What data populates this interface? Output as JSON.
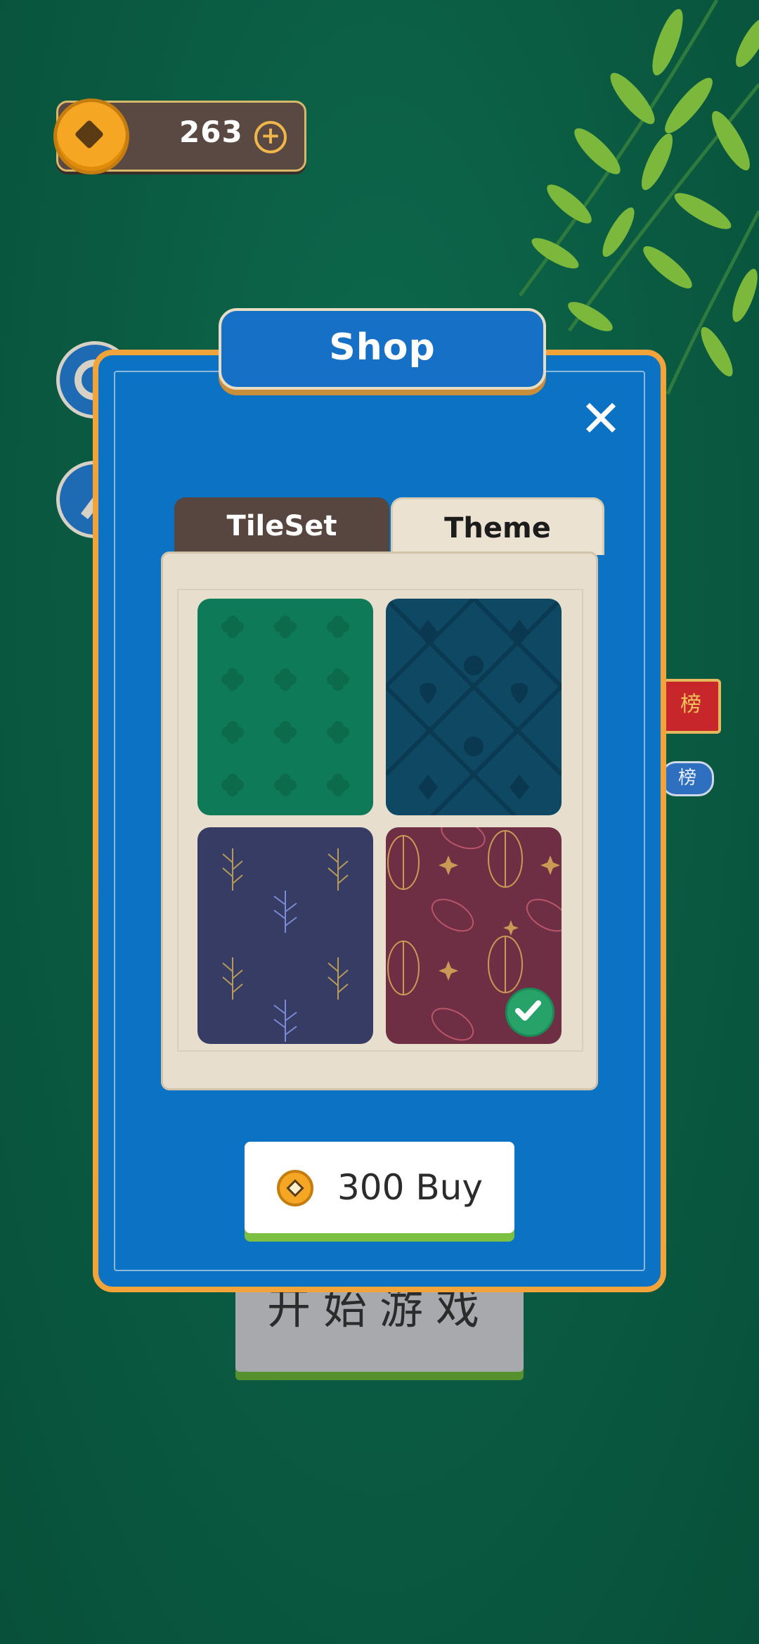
{
  "header": {
    "coins": "263",
    "add_coins_symbol": "+"
  },
  "background": {
    "start_button_label": "开始游戏",
    "rank_scroll_text": "榜",
    "rank_tag_text": "榜"
  },
  "dialog": {
    "title": "Shop",
    "close_symbol": "✕",
    "tabs": [
      {
        "label": "TileSet",
        "selected": false
      },
      {
        "label": "Theme",
        "selected": true
      }
    ],
    "themes": [
      {
        "name": "green-clover",
        "color": "#0f7a57",
        "selected": false
      },
      {
        "name": "teal-card-suits",
        "color": "#0e4863",
        "selected": false
      },
      {
        "name": "navy-leaves",
        "color": "#373c65",
        "selected": false
      },
      {
        "name": "wine-leaves",
        "color": "#6e2f44",
        "selected": true
      }
    ],
    "buy_button": {
      "price_and_label": "300 Buy",
      "icon": "coin-icon"
    }
  },
  "colors": {
    "background": "#0b5e45",
    "dialog": "#0b72c4",
    "dialog_border": "#f2a33a",
    "selected_check": "#27a36a",
    "buy_button_shadow": "#7bc043"
  }
}
